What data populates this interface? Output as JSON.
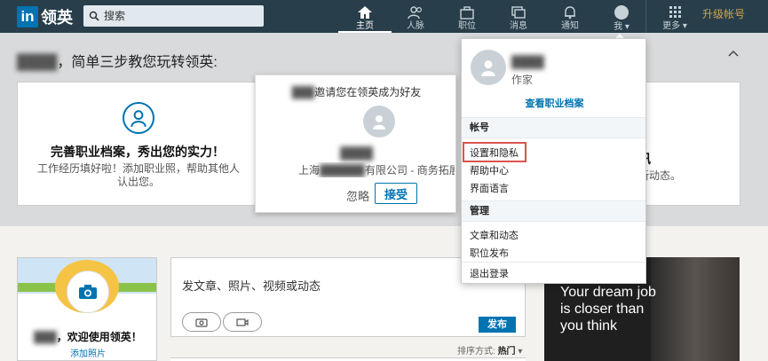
{
  "header": {
    "logo_text": "领英",
    "search_placeholder": "搜索",
    "nav": [
      {
        "label": "主页",
        "icon": "home-icon"
      },
      {
        "label": "人脉",
        "icon": "people-icon"
      },
      {
        "label": "职位",
        "icon": "briefcase-icon"
      },
      {
        "label": "消息",
        "icon": "message-icon"
      },
      {
        "label": "通知",
        "icon": "bell-icon"
      },
      {
        "label": "我",
        "icon": "me-avatar"
      },
      {
        "label": "更多",
        "icon": "grid-icon"
      }
    ],
    "upgrade": "升级帐号"
  },
  "banner": {
    "title_suffix": "，简单三步教您玩转领英:",
    "card1": {
      "title": "完善职业档案，秀出您的实力！",
      "desc": "工作经历填好啦！添加职业照，帮助其他人认出您。"
    },
    "invite": {
      "text_suffix": "邀请您在领英成为好友",
      "company_prefix": "上海",
      "company_suffix": "有限公司 - 商务拓展",
      "ignore": "忽略",
      "accept": "接受"
    },
    "card3": {
      "title": "讯",
      "desc": "最新动态。"
    }
  },
  "profile": {
    "welcome_suffix": "，欢迎使用领英！",
    "add_photo": "添加照片"
  },
  "post": {
    "prompt": "发文章、照片、视频或动态",
    "publish": "发布",
    "sort_label": "排序方式:",
    "sort_value": "热门"
  },
  "ad": {
    "text": "Your dream job is closer than you think"
  },
  "dropdown": {
    "role": "作家",
    "view_profile": "查看职业档案",
    "section_account": "帐号",
    "settings": "设置和隐私",
    "help": "帮助中心",
    "language": "界面语言",
    "section_manage": "管理",
    "posts": "文章和动态",
    "job_posts": "职位发布",
    "signout": "退出登录"
  },
  "colors": {
    "topbar": "#283e4a",
    "brand": "#0073b1",
    "upgrade": "#cfa64e",
    "highlight": "#d9534f"
  }
}
